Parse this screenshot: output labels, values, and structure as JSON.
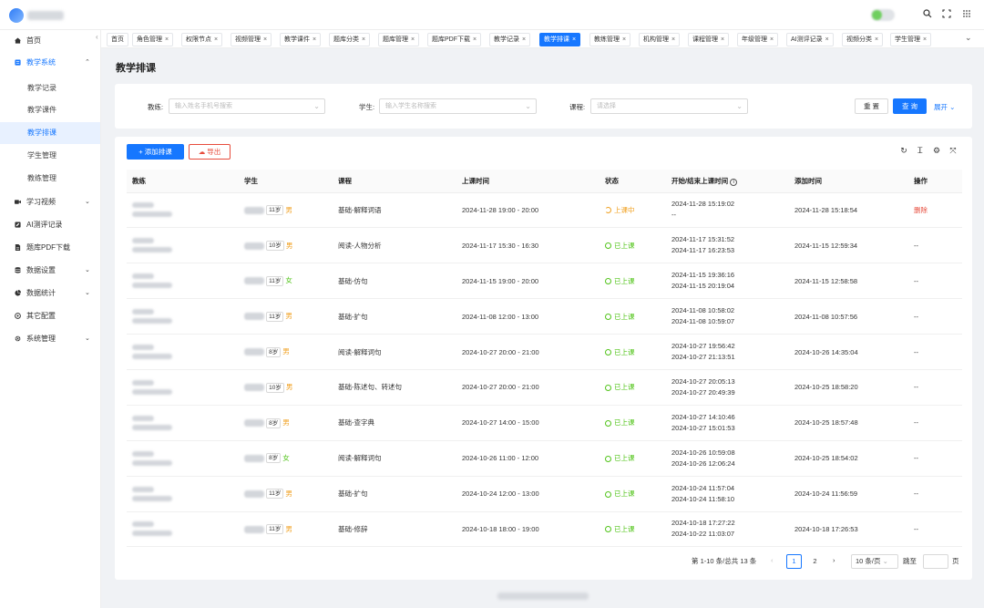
{
  "app": {
    "top_icons": [
      "search-icon",
      "fullscreen-icon",
      "apps-icon"
    ]
  },
  "sidebar": {
    "items": [
      {
        "label": "首页",
        "icon": "home-icon"
      },
      {
        "label": "教学系统",
        "icon": "book-icon",
        "expanded": true
      },
      {
        "label": "学习视频",
        "icon": "video-icon"
      },
      {
        "label": "AI测评记录",
        "icon": "edit-icon"
      },
      {
        "label": "题库PDF下载",
        "icon": "file-icon"
      },
      {
        "label": "数据设置",
        "icon": "database-icon"
      },
      {
        "label": "数据统计",
        "icon": "pie-chart-icon"
      },
      {
        "label": "其它配置",
        "icon": "settings-circle-icon"
      },
      {
        "label": "系统管理",
        "icon": "gear-icon"
      }
    ],
    "sub_items": [
      "教学记录",
      "教学课件",
      "教学排课",
      "学生管理",
      "教练管理"
    ],
    "active_sub": "教学排课"
  },
  "tabs": [
    "首页",
    "角色管理",
    "权限节点",
    "视频管理",
    "教学课件",
    "题库分类",
    "题库管理",
    "题库PDF下载",
    "教学记录",
    "教学排课",
    "教练管理",
    "机构管理",
    "课程管理",
    "年级管理",
    "AI测评记录",
    "视频分类",
    "学生管理"
  ],
  "active_tab": "教学排课",
  "page": {
    "title": "教学排课"
  },
  "filters": {
    "coach_label": "教练:",
    "coach_placeholder": "输入姓名手机号搜索",
    "student_label": "学生:",
    "student_placeholder": "输入学生名称搜索",
    "course_label": "课程:",
    "course_placeholder": "请选择",
    "reset": "重 置",
    "query": "查 询",
    "expand": "展开"
  },
  "toolbar": {
    "add": "+ 添加排课",
    "export": "导出"
  },
  "table": {
    "headers": [
      "教练",
      "学生",
      "课程",
      "上课时间",
      "状态",
      "开始/结束上课时间",
      "添加时间",
      "操作"
    ],
    "rows": [
      {
        "age": "11岁",
        "gender": "男",
        "course": "基础-解释词语",
        "time": "2024-11-28 19:00 - 20:00",
        "status": "上课中",
        "start": "2024-11-28 15:19:02",
        "end": "--",
        "added": "2024-11-28 15:18:54",
        "action": "删除"
      },
      {
        "age": "10岁",
        "gender": "男",
        "course": "阅读-人物分析",
        "time": "2024-11-17 15:30 - 16:30",
        "status": "已上课",
        "start": "2024-11-17 15:31:52",
        "end": "2024-11-17 16:23:53",
        "added": "2024-11-15 12:59:34",
        "action": "--"
      },
      {
        "age": "11岁",
        "gender": "女",
        "course": "基础-仿句",
        "time": "2024-11-15 19:00 - 20:00",
        "status": "已上课",
        "start": "2024-11-15 19:36:16",
        "end": "2024-11-15 20:19:04",
        "added": "2024-11-15 12:58:58",
        "action": "--"
      },
      {
        "age": "11岁",
        "gender": "男",
        "course": "基础-扩句",
        "time": "2024-11-08 12:00 - 13:00",
        "status": "已上课",
        "start": "2024-11-08 10:58:02",
        "end": "2024-11-08 10:59:07",
        "added": "2024-11-08 10:57:56",
        "action": "--"
      },
      {
        "age": "8岁",
        "gender": "男",
        "course": "阅读-解释词句",
        "time": "2024-10-27 20:00 - 21:00",
        "status": "已上课",
        "start": "2024-10-27 19:56:42",
        "end": "2024-10-27 21:13:51",
        "added": "2024-10-26 14:35:04",
        "action": "--"
      },
      {
        "age": "10岁",
        "gender": "男",
        "course": "基础-陈述句、转述句",
        "time": "2024-10-27 20:00 - 21:00",
        "status": "已上课",
        "start": "2024-10-27 20:05:13",
        "end": "2024-10-27 20:49:39",
        "added": "2024-10-25 18:58:20",
        "action": "--"
      },
      {
        "age": "8岁",
        "gender": "男",
        "course": "基础-查字典",
        "time": "2024-10-27 14:00 - 15:00",
        "status": "已上课",
        "start": "2024-10-27 14:10:46",
        "end": "2024-10-27 15:01:53",
        "added": "2024-10-25 18:57:48",
        "action": "--"
      },
      {
        "age": "8岁",
        "gender": "女",
        "course": "阅读-解释词句",
        "time": "2024-10-26 11:00 - 12:00",
        "status": "已上课",
        "start": "2024-10-26 10:59:08",
        "end": "2024-10-26 12:06:24",
        "added": "2024-10-25 18:54:02",
        "action": "--"
      },
      {
        "age": "11岁",
        "gender": "男",
        "course": "基础-扩句",
        "time": "2024-10-24 12:00 - 13:00",
        "status": "已上课",
        "start": "2024-10-24 11:57:04",
        "end": "2024-10-24 11:58:10",
        "added": "2024-10-24 11:56:59",
        "action": "--"
      },
      {
        "age": "11岁",
        "gender": "男",
        "course": "基础-修辞",
        "time": "2024-10-18 18:00 - 19:00",
        "status": "已上课",
        "start": "2024-10-18 17:27:22",
        "end": "2024-10-22 11:03:07",
        "added": "2024-10-18 17:26:53",
        "action": "--"
      }
    ]
  },
  "pagination": {
    "summary": "第 1-10 条/总共 13 条",
    "pages": [
      "1",
      "2"
    ],
    "current": "1",
    "page_size": "10 条/页",
    "jump_label": "跳至",
    "page_suffix": "页"
  },
  "colors": {
    "primary": "#1677ff",
    "success": "#52c41a",
    "warning": "#f0a020",
    "danger": "#e74c3c"
  }
}
